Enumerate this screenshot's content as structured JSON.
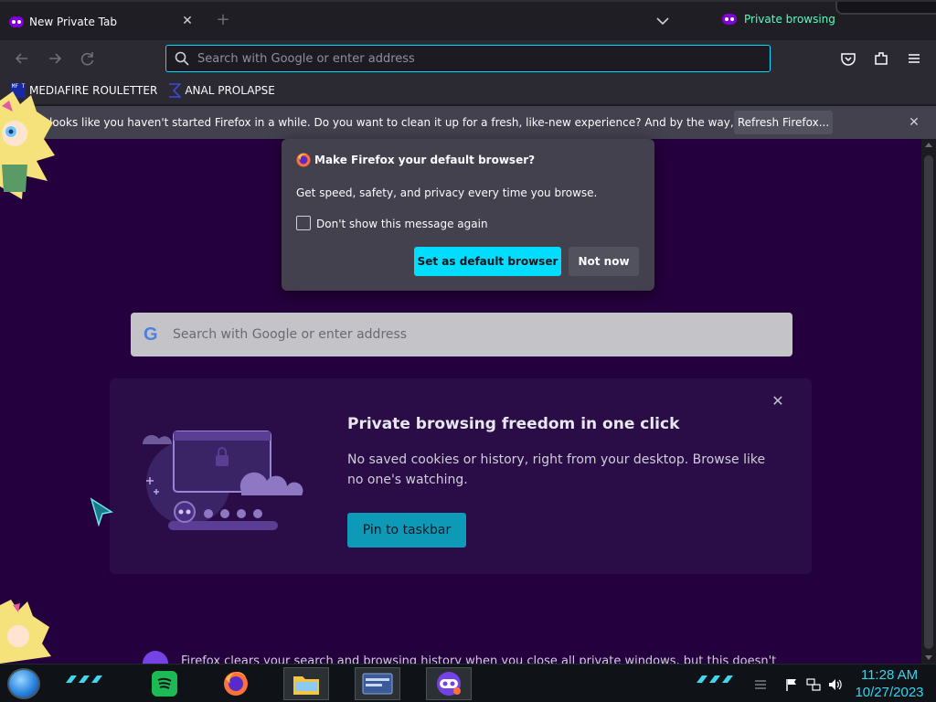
{
  "tabstrip": {
    "tab_label": "New Private Tab",
    "private_label": "Private browsing",
    "new_tab_symbol": "+",
    "close_symbol": "✕"
  },
  "navbar": {
    "url_placeholder": "Search with Google or enter address"
  },
  "bookmarks": [
    {
      "label": "MEDIAFIRE ROULETTER",
      "icon_text": "MF T"
    },
    {
      "label": "ANAL PROLAPSE"
    }
  ],
  "notification": {
    "text": "looks like you haven't started Firefox in a while. Do you want to clean it up for a fresh, like-new experience? And by the way, welcome back!",
    "button_label": "Refresh Firefox...",
    "close_symbol": "✕"
  },
  "popup": {
    "title": "Make Firefox your default browser?",
    "body": "Get speed, safety, and privacy every time you browse.",
    "checkbox_label": "Don't show this message again",
    "primary_label": "Set as default browser",
    "secondary_label": "Not now"
  },
  "content": {
    "search_placeholder": "Search with Google or enter address",
    "google_letter": "G",
    "promo_title": "Private browsing freedom in one click",
    "promo_body": "No saved cookies or history, right from your desktop. Browse like no one's watching.",
    "promo_button": "Pin to taskbar",
    "promo_close": "✕",
    "bottom_text": "Firefox clears your search and browsing history when you close all private windows, but this doesn't"
  },
  "taskbar": {
    "time": "11:28 AM",
    "date": "10/27/2023"
  },
  "colors": {
    "accent": "#00ddff",
    "private_green": "#54ffbd",
    "content_bg": "#25003e",
    "clock": "#34d4f0"
  }
}
